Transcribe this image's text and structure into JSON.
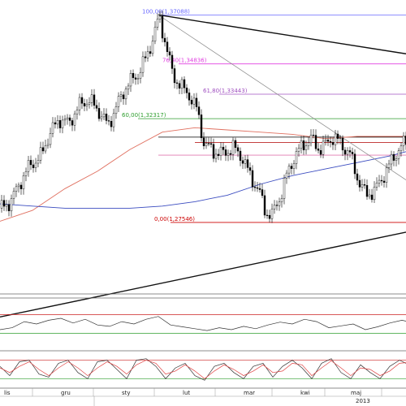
{
  "chart_data": {
    "type": "candlestick",
    "x_axis": {
      "months": [
        "lis",
        "gru",
        "sty",
        "lut",
        "mar",
        "kwi",
        "maj"
      ],
      "year_label": "2013"
    },
    "price_range": [
      1.262,
      1.374
    ],
    "fibonacci": {
      "levels": [
        {
          "label": "100,00(1,37088)",
          "value": 1.37088,
          "color": "#6a6aff"
        },
        {
          "label": "76,40(1,34836)",
          "value": 1.34836,
          "color": "#e040e0"
        },
        {
          "label": "61,80(1,33443)",
          "value": 1.33443,
          "color": "#a050c0"
        },
        {
          "label": "60,00(1,32317)",
          "value": 1.32317,
          "color": "#2e9e2e"
        },
        {
          "label": "",
          "value": 1.3147,
          "color": "#000000"
        },
        {
          "label": "",
          "value": 1.3122,
          "color": "#b00000"
        },
        {
          "label": "",
          "value": 1.3064,
          "color": "#e07ab0"
        },
        {
          "label": "0,00(1,27546)",
          "value": 1.27546,
          "color": "#cc0000"
        }
      ]
    },
    "trendlines": [
      {
        "name": "upper",
        "from": [
          1.37088,
          195
        ],
        "to": [
          1.353,
          500
        ]
      },
      {
        "name": "lower",
        "from": [
          1.232,
          0
        ],
        "to": [
          1.271,
          500
        ]
      },
      {
        "name": "thin",
        "from": [
          1.37088,
          195
        ],
        "to": [
          1.295,
          500
        ]
      }
    ],
    "moving_averages": [
      {
        "name": "MA-red",
        "color": "#e07060",
        "x": [
          0,
          40,
          80,
          120,
          160,
          200,
          240,
          280,
          320,
          360,
          400,
          440,
          480,
          500
        ],
        "y": [
          1.276,
          1.281,
          1.291,
          1.299,
          1.309,
          1.317,
          1.319,
          1.318,
          1.317,
          1.316,
          1.314,
          1.315,
          1.315,
          1.315
        ]
      },
      {
        "name": "MA-blue",
        "color": "#3b4cc0",
        "x": [
          0,
          40,
          80,
          120,
          160,
          200,
          240,
          280,
          320,
          360,
          400,
          440,
          480,
          500
        ],
        "y": [
          1.284,
          1.283,
          1.282,
          1.282,
          1.282,
          1.283,
          1.285,
          1.288,
          1.293,
          1.297,
          1.3,
          1.303,
          1.306,
          1.308
        ]
      }
    ],
    "price_path": {
      "x": [
        0,
        12,
        24,
        36,
        48,
        60,
        72,
        84,
        96,
        108,
        120,
        132,
        144,
        156,
        168,
        180,
        188,
        195,
        204,
        212,
        222,
        232,
        242,
        250,
        262,
        274,
        286,
        298,
        308,
        318,
        326,
        334,
        344,
        352,
        362,
        372,
        382,
        392,
        402,
        410,
        420,
        430,
        440,
        450,
        460,
        470,
        480,
        490,
        500
      ],
      "y": [
        1.282,
        1.285,
        1.294,
        1.302,
        1.305,
        1.316,
        1.323,
        1.321,
        1.329,
        1.332,
        1.327,
        1.32,
        1.33,
        1.339,
        1.343,
        1.352,
        1.361,
        1.37,
        1.356,
        1.343,
        1.338,
        1.334,
        1.327,
        1.312,
        1.308,
        1.307,
        1.31,
        1.305,
        1.296,
        1.29,
        1.28,
        1.279,
        1.287,
        1.297,
        1.306,
        1.311,
        1.314,
        1.309,
        1.312,
        1.315,
        1.311,
        1.307,
        1.295,
        1.288,
        1.29,
        1.296,
        1.303,
        1.309,
        1.313
      ]
    },
    "rsi": {
      "levels": {
        "upper": 70,
        "lower": 30
      },
      "x": [
        0,
        15,
        30,
        45,
        60,
        75,
        90,
        105,
        120,
        135,
        150,
        165,
        180,
        195,
        210,
        225,
        240,
        255,
        270,
        285,
        300,
        315,
        330,
        345,
        360,
        375,
        390,
        405,
        420,
        435,
        450,
        465,
        480,
        495,
        500
      ],
      "y": [
        38,
        42,
        55,
        50,
        58,
        62,
        52,
        60,
        48,
        45,
        55,
        50,
        60,
        66,
        48,
        44,
        40,
        36,
        42,
        38,
        45,
        40,
        48,
        54,
        50,
        60,
        55,
        42,
        46,
        50,
        38,
        44,
        52,
        58,
        56
      ]
    },
    "stochastic": {
      "x": [
        0,
        12,
        24,
        36,
        48,
        60,
        72,
        84,
        96,
        108,
        120,
        132,
        144,
        156,
        168,
        180,
        192,
        204,
        216,
        228,
        240,
        252,
        264,
        276,
        288,
        300,
        312,
        324,
        336,
        348,
        360,
        372,
        384,
        396,
        408,
        420,
        432,
        444,
        456,
        468,
        480,
        492,
        500
      ],
      "k": [
        60,
        30,
        75,
        80,
        35,
        25,
        70,
        80,
        40,
        20,
        75,
        80,
        50,
        20,
        80,
        85,
        60,
        20,
        55,
        70,
        30,
        15,
        60,
        70,
        40,
        20,
        60,
        70,
        25,
        60,
        80,
        55,
        20,
        70,
        85,
        40,
        20,
        65,
        40,
        20,
        60,
        80,
        70
      ],
      "d": [
        55,
        40,
        60,
        75,
        50,
        30,
        55,
        75,
        55,
        30,
        55,
        75,
        60,
        35,
        65,
        80,
        70,
        35,
        45,
        65,
        45,
        20,
        45,
        65,
        50,
        30,
        45,
        65,
        40,
        45,
        70,
        65,
        30,
        55,
        78,
        55,
        30,
        55,
        50,
        30,
        45,
        70,
        72
      ]
    }
  }
}
